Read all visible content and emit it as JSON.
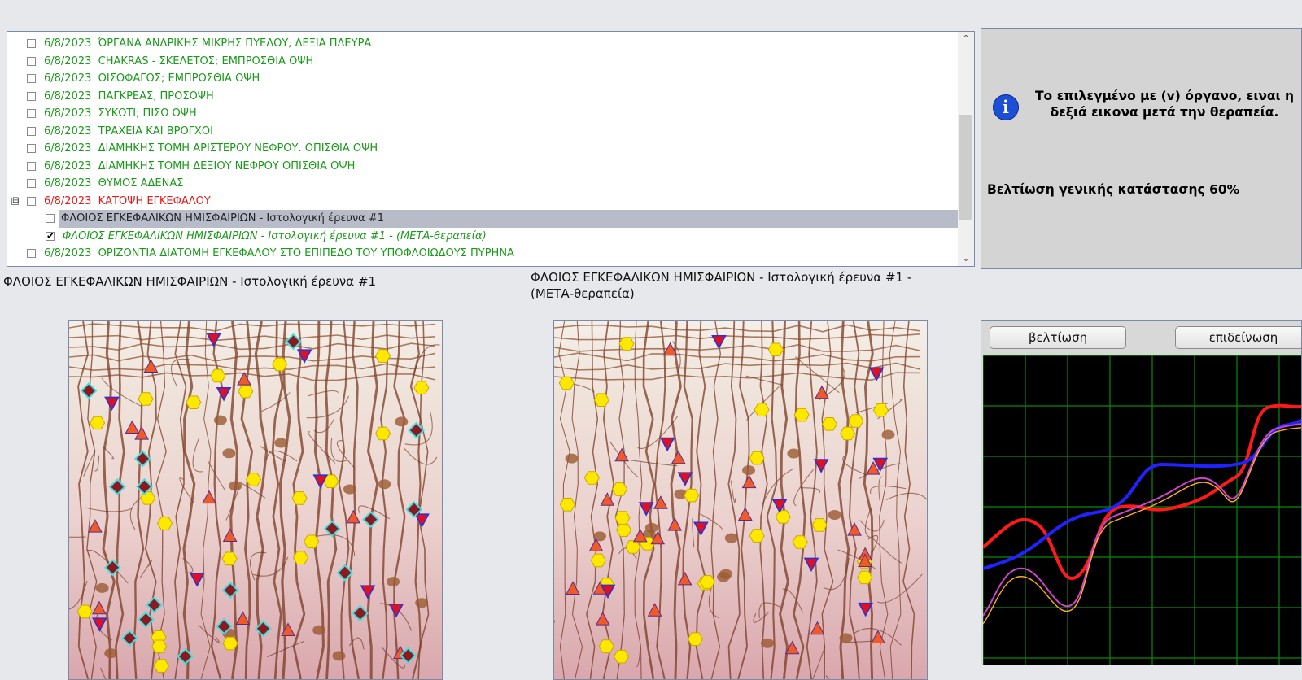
{
  "tree": {
    "rows": [
      {
        "date": "6/8/2023",
        "label": "ΌΡΓΑΝΑ ΑΝΔΡΙΚΗΣ ΜΙΚΡΗΣ ΠΥΕΛΟΥ, ΔΕΞΙΑ ΠΛΕΥΡΑ"
      },
      {
        "date": "6/8/2023",
        "label": "CHAKRAS - ΣΚΕΛΕΤΟΣ; ΕΜΠΡΟΣΘΙΑ ΟΨΗ"
      },
      {
        "date": "6/8/2023",
        "label": "ΟΙΣΟΦΑΓΟΣ; ΕΜΠΡΟΣΘΙΑ ΟΨΗ"
      },
      {
        "date": "6/8/2023",
        "label": "ΠΑΓΚΡΕΑΣ, ΠΡΟΣΟΨΗ"
      },
      {
        "date": "6/8/2023",
        "label": "ΣΥΚΩΤΙ; ΠΙΣΩ ΟΨΗ"
      },
      {
        "date": "6/8/2023",
        "label": "ΤΡΑΧΕΙΑ ΚΑΙ ΒΡΟΓΧΟΙ"
      },
      {
        "date": "6/8/2023",
        "label": "ΔΙΑΜΗΚΗΣ ΤΟΜΗ ΑΡΙΣΤΕΡΟΥ ΝΕΦΡΟΥ. ΟΠΙΣΘΙΑ ΟΨΗ"
      },
      {
        "date": "6/8/2023",
        "label": "ΔΙΑΜΗΚΗΣ ΤΟΜΗ ΔΕΞΙΟΥ ΝΕΦΡΟΥ  ΟΠΙΣΘΙΑ ΟΨΗ"
      },
      {
        "date": "6/8/2023",
        "label": "ΘΥΜΟΣ ΑΔΕΝΑΣ"
      },
      {
        "date": "6/8/2023",
        "label": "ΚΑΤΟΨΗ ΕΓΚΕΦΑΛΟΥ"
      },
      {
        "date": "",
        "label": "ΦΛΟΙΟΣ ΕΓΚΕΦΑΛΙΚΩΝ ΗΜΙΣΦΑΙΡΙΩΝ - Ιστολογική έρευνα #1"
      },
      {
        "date": "",
        "label": "ΦΛΟΙΟΣ ΕΓΚΕΦΑΛΙΚΩΝ ΗΜΙΣΦΑΙΡΙΩΝ - Ιστολογική έρευνα #1 - (ΜΕΤΑ-θεραπεία)"
      },
      {
        "date": "6/8/2023",
        "label": "ΟΡΙΖΟΝΤΙΑ ΔΙΑΤΟΜΗ ΕΓΚΕΦΑΛΟΥ ΣΤΟ ΕΠΙΠΕΔΟ ΤΟΥ ΥΠΟΦΛΟΙΩΔΟΥΣ ΠΥΡΗΝΑ"
      }
    ],
    "expander_symbol": "⊟",
    "checkmark": "✔",
    "scroll_up": "^",
    "scroll_down": "⌄"
  },
  "info": {
    "icon": "i",
    "message": "Το επιλεγμένο με (v) όργανο, ειναι η δεξιά εικονα μετά την θεραπεία.",
    "improvement": "Βελτίωση γενικής κατάστασης 60%"
  },
  "captions": {
    "left": "ΦΛΟΙΟΣ ΕΓΚΕΦΑΛΙΚΩΝ ΗΜΙΣΦΑΙΡΙΩΝ - Ιστολογική έρευνα #1",
    "right_line1": "ΦΛΟΙΟΣ ΕΓΚΕΦΑΛΙΚΩΝ ΗΜΙΣΦΑΙΡΙΩΝ - Ιστολογική έρευνα #1 -",
    "right_line2": "(ΜΕΤΑ-θεραπεία)"
  },
  "graph": {
    "btn_improve": "βελτίωση",
    "btn_worsen": "επιδείνωση"
  },
  "colors": {
    "green_text": "#1a9a1a",
    "red_text": "#e81818",
    "hexagon": "#ffe800",
    "triangle_up": "#f05a28",
    "triangle_down": "#e01020",
    "diamond": "#8a1a22",
    "diamond_border": "#3fe0e0",
    "grid": "#0a8a0a"
  }
}
